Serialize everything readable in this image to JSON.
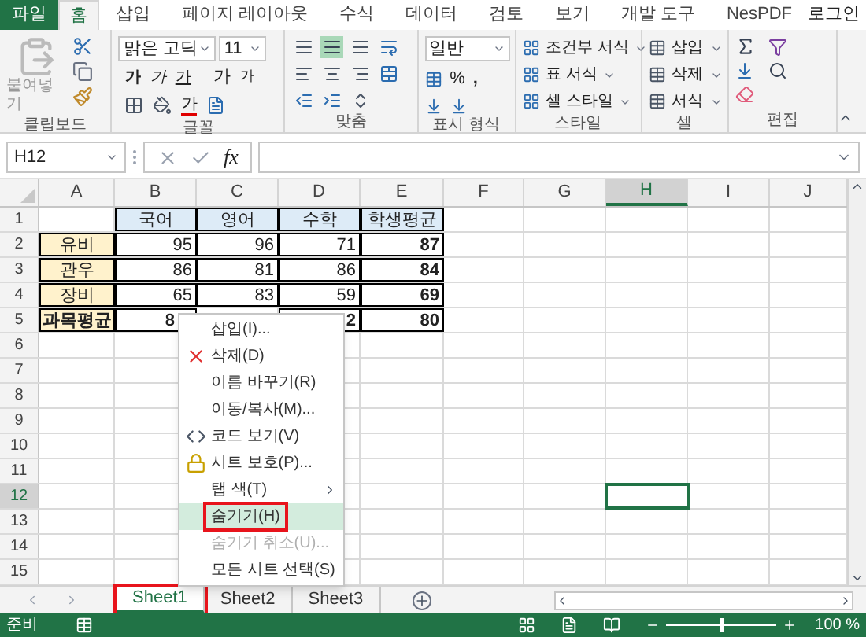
{
  "ribbon_tabs": [
    {
      "label": "파일",
      "kind": "file",
      "selected": false
    },
    {
      "label": "홈",
      "kind": "tab",
      "selected": true
    },
    {
      "label": "삽입",
      "kind": "tab",
      "selected": false
    },
    {
      "label": "페이지 레이아웃",
      "kind": "tab",
      "selected": false
    },
    {
      "label": "수식",
      "kind": "tab",
      "selected": false
    },
    {
      "label": "데이터",
      "kind": "tab",
      "selected": false
    },
    {
      "label": "검토",
      "kind": "tab",
      "selected": false
    },
    {
      "label": "보기",
      "kind": "tab",
      "selected": false
    },
    {
      "label": "개발 도구",
      "kind": "tab",
      "selected": false
    },
    {
      "label": "NesPDF",
      "kind": "tab",
      "selected": false
    }
  ],
  "sign_in": "로그인",
  "ribbon": {
    "paste_label": "붙여넣기",
    "font_name": "맑은 고딕",
    "font_size": "11",
    "font_glyphs": [
      "가",
      "가",
      "가",
      "가",
      "가",
      "가"
    ],
    "number_format": "일반",
    "percent": "%",
    "comma": ",",
    "style_commands": [
      "조건부 서식",
      "표 서식",
      "셀 스타일"
    ],
    "cell_commands": [
      "삽입",
      "삭제",
      "서식"
    ],
    "groups": [
      "클립보드",
      "글꼴",
      "맞춤",
      "표시 형식",
      "스타일",
      "셀",
      "편집"
    ]
  },
  "formula_bar": {
    "name_box": "H12",
    "fx": "fx"
  },
  "columns": [
    {
      "label": "A",
      "selected": false
    },
    {
      "label": "B",
      "selected": false
    },
    {
      "label": "C",
      "selected": false
    },
    {
      "label": "D",
      "selected": false
    },
    {
      "label": "E",
      "selected": false
    },
    {
      "label": "F",
      "selected": false
    },
    {
      "label": "G",
      "selected": false
    },
    {
      "label": "H",
      "selected": true
    },
    {
      "label": "I",
      "selected": false
    },
    {
      "label": "J",
      "selected": false
    }
  ],
  "rows": [
    {
      "header": "1",
      "selected": false,
      "cells": [
        {
          "kind": "blank"
        },
        {
          "kind": "header",
          "text": "국어"
        },
        {
          "kind": "header",
          "text": "영어"
        },
        {
          "kind": "header",
          "text": "수학"
        },
        {
          "kind": "header",
          "text": "학생평균"
        }
      ]
    },
    {
      "header": "2",
      "selected": false,
      "cells": [
        {
          "kind": "label",
          "text": "유비"
        },
        {
          "kind": "number",
          "text": "95"
        },
        {
          "kind": "number",
          "text": "96"
        },
        {
          "kind": "number",
          "text": "71"
        },
        {
          "kind": "total",
          "text": "87"
        }
      ]
    },
    {
      "header": "3",
      "selected": false,
      "cells": [
        {
          "kind": "label",
          "text": "관우"
        },
        {
          "kind": "number",
          "text": "86"
        },
        {
          "kind": "number",
          "text": "81"
        },
        {
          "kind": "number",
          "text": "86"
        },
        {
          "kind": "total",
          "text": "84"
        }
      ]
    },
    {
      "header": "4",
      "selected": false,
      "cells": [
        {
          "kind": "label",
          "text": "장비"
        },
        {
          "kind": "number",
          "text": "65"
        },
        {
          "kind": "number",
          "text": "83"
        },
        {
          "kind": "number",
          "text": "59"
        },
        {
          "kind": "total",
          "text": "69"
        }
      ]
    },
    {
      "header": "5",
      "selected": false,
      "cells": [
        {
          "kind": "totallabel",
          "text": "과목평균"
        },
        {
          "kind": "total",
          "text": "8"
        },
        {
          "kind": "blank"
        },
        {
          "kind": "total",
          "text": "2"
        },
        {
          "kind": "total",
          "text": "80"
        }
      ]
    },
    {
      "header": "6",
      "selected": false,
      "cells": []
    },
    {
      "header": "7",
      "selected": false,
      "cells": []
    },
    {
      "header": "8",
      "selected": false,
      "cells": []
    },
    {
      "header": "9",
      "selected": false,
      "cells": []
    },
    {
      "header": "10",
      "selected": false,
      "cells": []
    },
    {
      "header": "11",
      "selected": false,
      "cells": []
    },
    {
      "header": "12",
      "selected": true,
      "cells": []
    },
    {
      "header": "13",
      "selected": false,
      "cells": []
    },
    {
      "header": "14",
      "selected": false,
      "cells": []
    },
    {
      "header": "15",
      "selected": false,
      "cells": []
    }
  ],
  "context_menu": [
    {
      "label": "삽입(I)...",
      "kind": "plain",
      "disabled": false,
      "selected": false,
      "annotated": false
    },
    {
      "label": "삭제(D)",
      "kind": "delete",
      "disabled": false,
      "selected": false,
      "annotated": false
    },
    {
      "label": "이름 바꾸기(R)",
      "kind": "plain",
      "disabled": false,
      "selected": false,
      "annotated": false
    },
    {
      "label": "이동/복사(M)...",
      "kind": "plain",
      "disabled": false,
      "selected": false,
      "annotated": false
    },
    {
      "label": "코드 보기(V)",
      "kind": "code",
      "disabled": false,
      "selected": false,
      "annotated": false
    },
    {
      "label": "시트 보호(P)...",
      "kind": "protect",
      "disabled": false,
      "selected": false,
      "annotated": false
    },
    {
      "label": "탭 색(T)",
      "kind": "submenu",
      "disabled": false,
      "selected": false,
      "annotated": false
    },
    {
      "label": "숨기기(H)",
      "kind": "plain",
      "disabled": false,
      "selected": true,
      "annotated": true
    },
    {
      "label": "숨기기 취소(U)...",
      "kind": "plain",
      "disabled": true,
      "selected": false,
      "annotated": false
    },
    {
      "label": "모든 시트 선택(S)",
      "kind": "plain",
      "disabled": false,
      "selected": false,
      "annotated": false
    }
  ],
  "sheet_tabs": [
    {
      "label": "Sheet1",
      "selected": true,
      "annotated": true
    },
    {
      "label": "Sheet2",
      "selected": false,
      "annotated": false
    },
    {
      "label": "Sheet3",
      "selected": false,
      "annotated": false
    }
  ],
  "status_bar": {
    "text": "준비",
    "zoom": {
      "level": 0.5,
      "reading": "100 %"
    }
  }
}
